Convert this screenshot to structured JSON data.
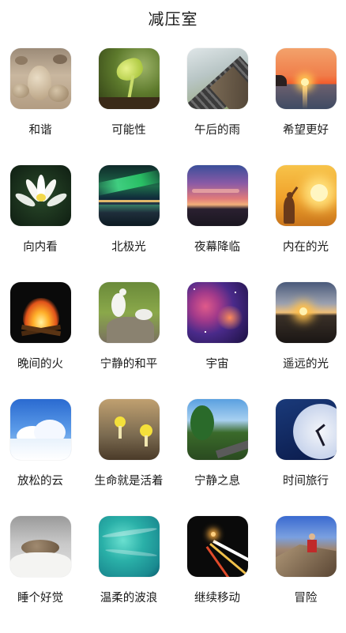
{
  "title": "减压室",
  "items": [
    {
      "label": "和谐",
      "icon": "zen-stones-icon"
    },
    {
      "label": "可能性",
      "icon": "seedling-sprout-icon"
    },
    {
      "label": "午后的雨",
      "icon": "roof-tiles-rain-icon"
    },
    {
      "label": "希望更好",
      "icon": "sunset-sea-icon"
    },
    {
      "label": "向内看",
      "icon": "white-lotus-icon"
    },
    {
      "label": "北极光",
      "icon": "aurora-lake-icon"
    },
    {
      "label": "夜幕降临",
      "icon": "dusk-sky-icon"
    },
    {
      "label": "内在的光",
      "icon": "woman-sunlight-icon"
    },
    {
      "label": "晚间的火",
      "icon": "campfire-icon"
    },
    {
      "label": "宁静的和平",
      "icon": "white-doves-icon"
    },
    {
      "label": "宇宙",
      "icon": "nebula-galaxy-icon"
    },
    {
      "label": "遥远的光",
      "icon": "distant-sunrise-icon"
    },
    {
      "label": "放松的云",
      "icon": "blue-sky-clouds-icon"
    },
    {
      "label": "生命就是活着",
      "icon": "yellow-mushrooms-icon"
    },
    {
      "label": "宁静之息",
      "icon": "tree-lined-road-icon"
    },
    {
      "label": "时间旅行",
      "icon": "clock-face-icon"
    },
    {
      "label": "睡个好觉",
      "icon": "sleeping-cat-icon"
    },
    {
      "label": "温柔的波浪",
      "icon": "turquoise-water-icon"
    },
    {
      "label": "继续移动",
      "icon": "night-traffic-trails-icon"
    },
    {
      "label": "冒险",
      "icon": "rock-climber-icon"
    }
  ]
}
